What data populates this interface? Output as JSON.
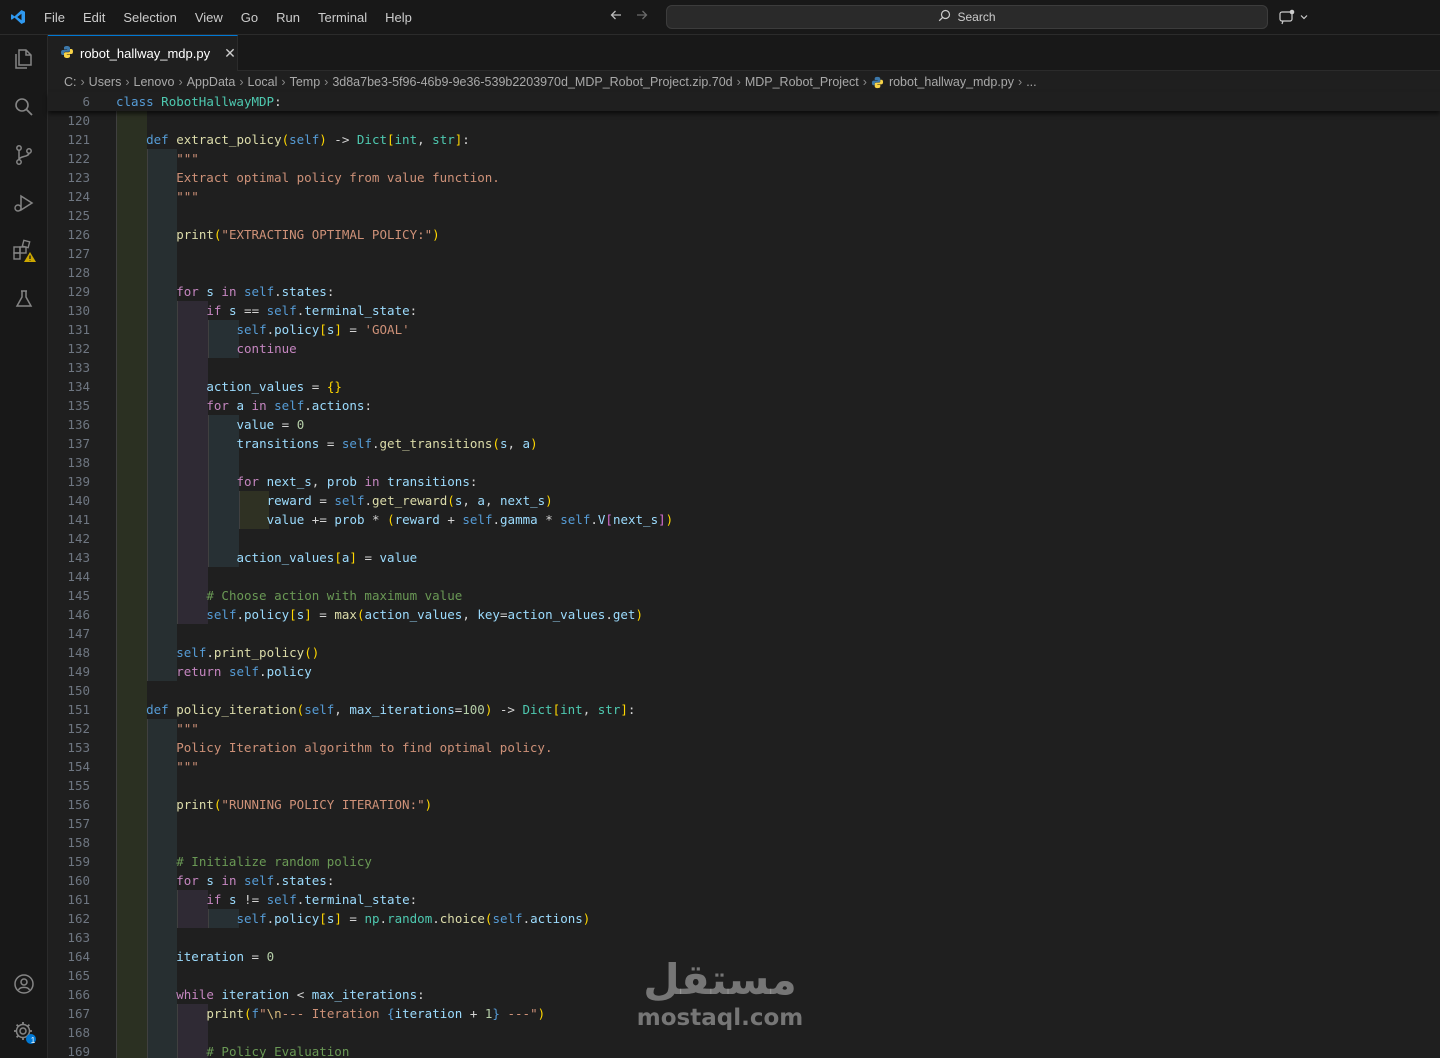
{
  "menu": [
    "File",
    "Edit",
    "Selection",
    "View",
    "Go",
    "Run",
    "Terminal",
    "Help"
  ],
  "search": {
    "placeholder": "Search"
  },
  "tab": {
    "label": "robot_hallway_mdp.py",
    "close": "✕"
  },
  "breadcrumb": [
    "C:",
    "Users",
    "Lenovo",
    "AppData",
    "Local",
    "Temp",
    "3d8a7be3-5f96-46b9-9e36-539b2203970d_MDP_Robot_Project.zip.70d",
    "MDP_Robot_Project",
    "robot_hallway_mdp.py",
    "..."
  ],
  "sticky": {
    "line": "6",
    "code": "class RobotHallwayMDP:"
  },
  "watermark": {
    "arabic": "مستقل",
    "latin": "mostaql.com"
  },
  "colors": {
    "accent": "#0078d4",
    "editor_bg": "#1f1f1f",
    "keyword": "#569cd6",
    "function": "#dcdcaa",
    "string": "#ce9178",
    "comment": "#6a9955",
    "warning": "#cca700"
  },
  "icons": [
    "vscode-logo-icon",
    "back-arrow-icon",
    "forward-arrow-icon",
    "search-icon",
    "copilot-icon",
    "explorer-icon",
    "search-view-icon",
    "source-control-icon",
    "run-debug-icon",
    "extensions-icon",
    "warning-icon",
    "testing-icon",
    "account-icon",
    "settings-icon",
    "python-file-icon",
    "close-icon",
    "chevron-right-icon"
  ],
  "badges": {
    "settings": "1"
  },
  "lines": [
    {
      "n": "120",
      "code": ""
    },
    {
      "n": "121",
      "code": "    def extract_policy(self) -> Dict[int, str]:"
    },
    {
      "n": "122",
      "code": "        \"\"\""
    },
    {
      "n": "123",
      "code": "        Extract optimal policy from value function."
    },
    {
      "n": "124",
      "code": "        \"\"\""
    },
    {
      "n": "125",
      "code": ""
    },
    {
      "n": "126",
      "code": "        print(\"EXTRACTING OPTIMAL POLICY:\")"
    },
    {
      "n": "127",
      "code": ""
    },
    {
      "n": "128",
      "code": ""
    },
    {
      "n": "129",
      "code": "        for s in self.states:"
    },
    {
      "n": "130",
      "code": "            if s == self.terminal_state:"
    },
    {
      "n": "131",
      "code": "                self.policy[s] = 'GOAL'"
    },
    {
      "n": "132",
      "code": "                continue"
    },
    {
      "n": "133",
      "code": ""
    },
    {
      "n": "134",
      "code": "            action_values = {}"
    },
    {
      "n": "135",
      "code": "            for a in self.actions:"
    },
    {
      "n": "136",
      "code": "                value = 0"
    },
    {
      "n": "137",
      "code": "                transitions = self.get_transitions(s, a)"
    },
    {
      "n": "138",
      "code": ""
    },
    {
      "n": "139",
      "code": "                for next_s, prob in transitions:"
    },
    {
      "n": "140",
      "code": "                    reward = self.get_reward(s, a, next_s)"
    },
    {
      "n": "141",
      "code": "                    value += prob * (reward + self.gamma * self.V[next_s])"
    },
    {
      "n": "142",
      "code": ""
    },
    {
      "n": "143",
      "code": "                action_values[a] = value"
    },
    {
      "n": "144",
      "code": ""
    },
    {
      "n": "145",
      "code": "            # Choose action with maximum value"
    },
    {
      "n": "146",
      "code": "            self.policy[s] = max(action_values, key=action_values.get)"
    },
    {
      "n": "147",
      "code": ""
    },
    {
      "n": "148",
      "code": "        self.print_policy()"
    },
    {
      "n": "149",
      "code": "        return self.policy"
    },
    {
      "n": "150",
      "code": ""
    },
    {
      "n": "151",
      "code": "    def policy_iteration(self, max_iterations=100) -> Dict[int, str]:"
    },
    {
      "n": "152",
      "code": "        \"\"\""
    },
    {
      "n": "153",
      "code": "        Policy Iteration algorithm to find optimal policy."
    },
    {
      "n": "154",
      "code": "        \"\"\""
    },
    {
      "n": "155",
      "code": ""
    },
    {
      "n": "156",
      "code": "        print(\"RUNNING POLICY ITERATION:\")"
    },
    {
      "n": "157",
      "code": ""
    },
    {
      "n": "158",
      "code": ""
    },
    {
      "n": "159",
      "code": "        # Initialize random policy"
    },
    {
      "n": "160",
      "code": "        for s in self.states:"
    },
    {
      "n": "161",
      "code": "            if s != self.terminal_state:"
    },
    {
      "n": "162",
      "code": "                self.policy[s] = np.random.choice(self.actions)"
    },
    {
      "n": "163",
      "code": ""
    },
    {
      "n": "164",
      "code": "        iteration = 0"
    },
    {
      "n": "165",
      "code": ""
    },
    {
      "n": "166",
      "code": "        while iteration < max_iterations:"
    },
    {
      "n": "167",
      "code": "            print(f\"\\n--- Iteration {iteration + 1} ---\")"
    },
    {
      "n": "168",
      "code": ""
    },
    {
      "n": "169",
      "code": "            # Policy Evaluation"
    }
  ]
}
